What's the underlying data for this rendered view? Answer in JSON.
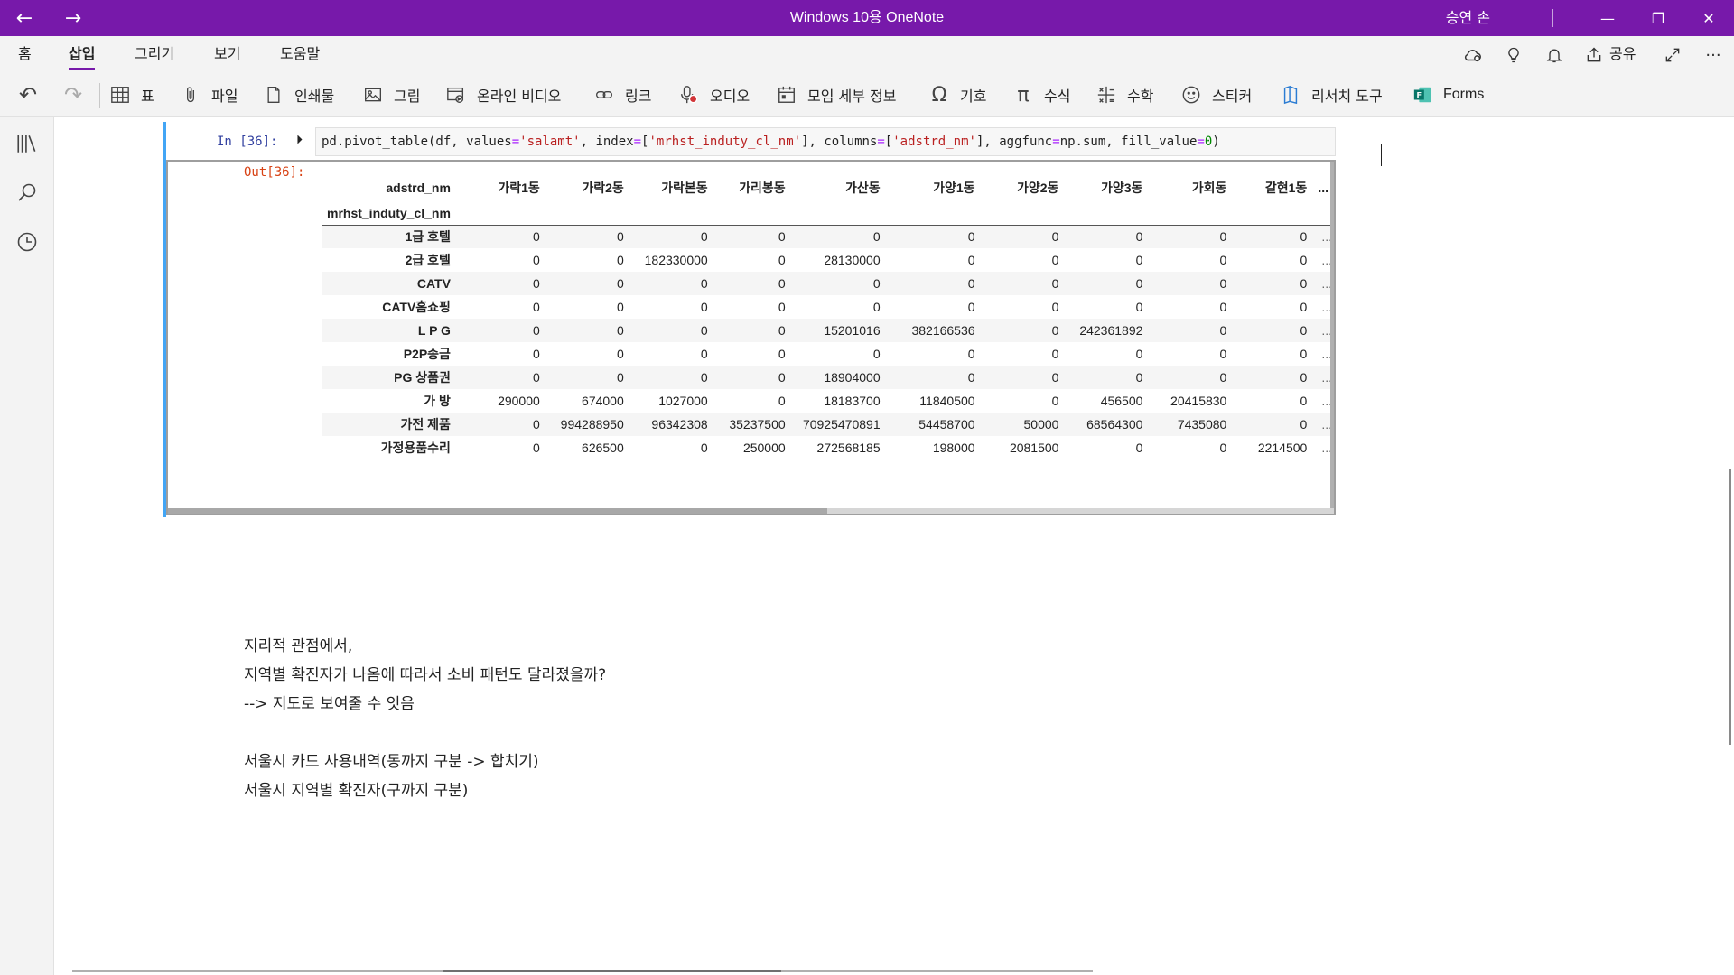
{
  "window": {
    "title": "Windows 10용 OneNote",
    "user": "승연 손",
    "nav_back": "←",
    "nav_forward": "→",
    "minimize": "—",
    "restore": "❐",
    "close": "✕"
  },
  "menu": {
    "tabs": [
      "홈",
      "삽입",
      "그리기",
      "보기",
      "도움말"
    ],
    "active_tab": "삽입",
    "share_label": "공유",
    "more": "···"
  },
  "ribbon": {
    "undo": "↶",
    "redo": "↷",
    "items": [
      {
        "label": "표",
        "icon": "table-icon"
      },
      {
        "label": "파일",
        "icon": "paperclip-icon"
      },
      {
        "label": "인쇄물",
        "icon": "document-icon"
      },
      {
        "label": "그림",
        "icon": "picture-icon"
      },
      {
        "label": "온라인 비디오",
        "icon": "video-icon"
      },
      {
        "label": "링크",
        "icon": "link-icon"
      },
      {
        "label": "오디오",
        "icon": "audio-icon"
      },
      {
        "label": "모임 세부 정보",
        "icon": "calendar-icon"
      },
      {
        "label": "기호",
        "icon": "omega-icon"
      },
      {
        "label": "수식",
        "icon": "pi-icon"
      },
      {
        "label": "수학",
        "icon": "math-icon"
      },
      {
        "label": "스티커",
        "icon": "smiley-icon"
      },
      {
        "label": "리서치 도구",
        "icon": "research-icon"
      },
      {
        "label": "Forms",
        "icon": "forms-icon"
      }
    ]
  },
  "cell": {
    "in_prompt": "In [36]:",
    "out_prompt": "Out[36]:",
    "run_icon": "⏵",
    "code": {
      "p1": "pd.pivot_table(df, values",
      "eq1": "=",
      "s1": "'salamt'",
      "p2": ", index",
      "eq2": "=",
      "p3": "[",
      "s2": "'mrhst_induty_cl_nm'",
      "p4": "], columns",
      "eq3": "=",
      "p5": "[",
      "s3": "'adstrd_nm'",
      "p6": "], aggfunc",
      "eq4": "=",
      "p7": "np.sum, fill_value",
      "eq5": "=",
      "n1": "0",
      "p8": ")"
    }
  },
  "dataframe": {
    "columns_name": "adstrd_nm",
    "index_name": "mrhst_induty_cl_nm",
    "columns": [
      "가락1동",
      "가락2동",
      "가락본동",
      "가리봉동",
      "가산동",
      "가양1동",
      "가양2동",
      "가양3동",
      "가회동",
      "갈현1동"
    ],
    "ellipsis": "...",
    "rows": [
      {
        "index": "1급 호텔",
        "values": [
          "0",
          "0",
          "0",
          "0",
          "0",
          "0",
          "0",
          "0",
          "0",
          "0"
        ]
      },
      {
        "index": "2급 호텔",
        "values": [
          "0",
          "0",
          "182330000",
          "0",
          "28130000",
          "0",
          "0",
          "0",
          "0",
          "0"
        ]
      },
      {
        "index": "CATV",
        "values": [
          "0",
          "0",
          "0",
          "0",
          "0",
          "0",
          "0",
          "0",
          "0",
          "0"
        ]
      },
      {
        "index": "CATV홈쇼핑",
        "values": [
          "0",
          "0",
          "0",
          "0",
          "0",
          "0",
          "0",
          "0",
          "0",
          "0"
        ]
      },
      {
        "index": "L P G",
        "values": [
          "0",
          "0",
          "0",
          "0",
          "15201016",
          "382166536",
          "0",
          "242361892",
          "0",
          "0"
        ]
      },
      {
        "index": "P2P송금",
        "values": [
          "0",
          "0",
          "0",
          "0",
          "0",
          "0",
          "0",
          "0",
          "0",
          "0"
        ]
      },
      {
        "index": "PG 상품권",
        "values": [
          "0",
          "0",
          "0",
          "0",
          "18904000",
          "0",
          "0",
          "0",
          "0",
          "0"
        ]
      },
      {
        "index": "가 방",
        "values": [
          "290000",
          "674000",
          "1027000",
          "0",
          "18183700",
          "11840500",
          "0",
          "456500",
          "20415830",
          "0"
        ]
      },
      {
        "index": "가전 제품",
        "values": [
          "0",
          "994288950",
          "96342308",
          "35237500",
          "70925470891",
          "54458700",
          "50000",
          "68564300",
          "7435080",
          "0"
        ]
      },
      {
        "index": "가정용품수리",
        "values": [
          "0",
          "626500",
          "0",
          "250000",
          "272568185",
          "198000",
          "2081500",
          "0",
          "0",
          "2214500"
        ]
      }
    ]
  },
  "notes": {
    "line1": "지리적 관점에서,",
    "line2": "지역별 확진자가 나옴에 따라서 소비 패턴도 달라졌을까?",
    "line3": "--> 지도로 보여줄 수 잇음",
    "line4": "서울시 카드 사용내역(동까지 구분 -> 합치기)",
    "line5": "서울시 지역별 확진자(구까지 구분)"
  }
}
